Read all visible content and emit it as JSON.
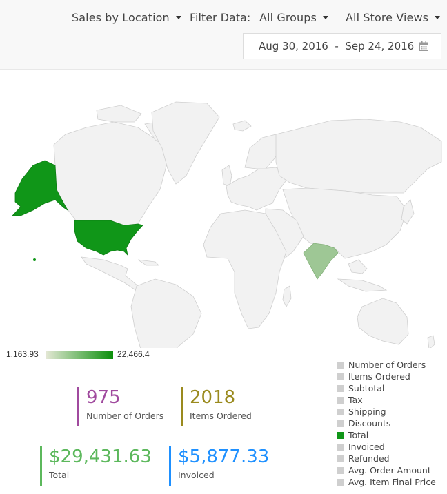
{
  "toolbar": {
    "report_select": "Sales by Location",
    "filter_label": "Filter Data:",
    "group_select": "All Groups",
    "store_select": "All Store Views",
    "date_from": "Aug 30, 2016",
    "date_sep": "-",
    "date_to": "Sep 24, 2016"
  },
  "map": {
    "scale_min": "1,163.93",
    "scale_max": "22,466.4",
    "highlighted": [
      "United States",
      "India"
    ],
    "colors": {
      "land": "#f2f2f2",
      "border": "#cfcfcf",
      "high": "#109618",
      "mid": "#9ec795",
      "low": "#e5e8d6"
    }
  },
  "stats": {
    "orders": {
      "value": "975",
      "label": "Number of Orders",
      "color": "#a04a9e"
    },
    "items": {
      "value": "2018",
      "label": "Items Ordered",
      "color": "#9a8a1e"
    },
    "total": {
      "value": "$29,431.63",
      "label": "Total",
      "color": "#5cb85c"
    },
    "invoiced": {
      "value": "$5,877.33",
      "label": "Invoiced",
      "color": "#1e90ff"
    }
  },
  "legend": {
    "items": [
      "Number of Orders",
      "Items Ordered",
      "Subtotal",
      "Tax",
      "Shipping",
      "Discounts",
      "Total",
      "Invoiced",
      "Refunded",
      "Avg. Order Amount",
      "Avg. Item Final Price"
    ],
    "active": "Total"
  }
}
